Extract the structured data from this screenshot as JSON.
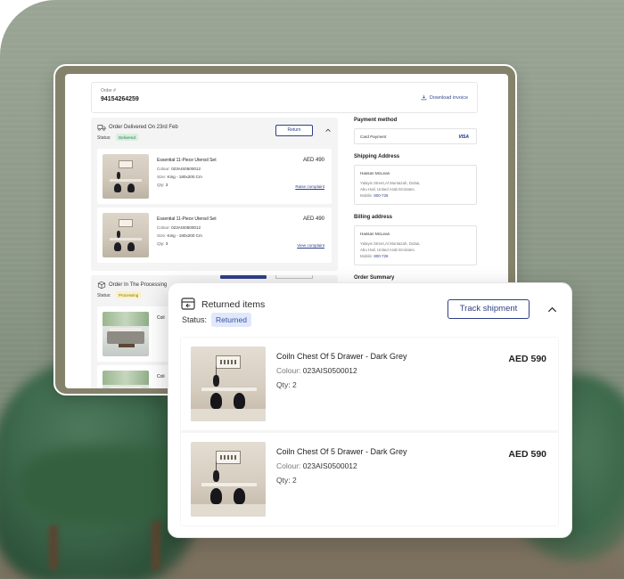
{
  "background_screen": {
    "order": {
      "label": "Order #",
      "number": "94154264259",
      "download_label": "Download invoice"
    },
    "panels": [
      {
        "title": "Order Delivered On 23rd Feb",
        "status_label": "Status:",
        "status": "Delivered",
        "action_label": "Return",
        "items": [
          {
            "name": "Essential 11-Piece Utensil Set",
            "colour_label": "Colour:",
            "colour": "023AIS0500012",
            "size_label": "Size:",
            "size": "King - 180x200 Cm",
            "qty_label": "Qty:",
            "qty": "3",
            "price": "AED 490",
            "link": "Raise complaint"
          },
          {
            "name": "Essential 11-Piece Utensil Set",
            "colour_label": "Colour:",
            "colour": "023AIS0500012",
            "size_label": "Size:",
            "size": "King - 180x200 Cm",
            "qty_label": "Qty:",
            "qty": "3",
            "price": "AED 490",
            "link": "View complaint"
          }
        ]
      },
      {
        "title": "Order In The Processing",
        "status_label": "Status:",
        "status": "Processing",
        "items": [
          {
            "name": "Coli"
          },
          {
            "name": "Coli"
          }
        ]
      }
    ],
    "sidebar": {
      "payment_title": "Payment method",
      "payment_value": "Card Payment",
      "payment_brand": "VISA",
      "shipping_title": "Shipping Address",
      "shipping": {
        "name": "Hassan McLean",
        "line1": "Yalayis Street,Al Muntazah, Dubai,",
        "line2": "Abu Hail, United Arab Emirates.",
        "mobile_label": "Mobile:",
        "mobile": "800-726"
      },
      "billing_title": "Billing address",
      "billing": {
        "name": "Hassan McLean",
        "line1": "Yalayis Street,Al Muntazah, Dubai,",
        "line2": "Abu Hail, United Arab Emirates.",
        "mobile_label": "Mobile:",
        "mobile": "800-726"
      },
      "summary_title": "Order Summary"
    }
  },
  "returned_card": {
    "title": "Returned items",
    "status_label": "Status:",
    "status": "Returned",
    "track_label": "Track shipment",
    "items": [
      {
        "name": "Coiln Chest Of 5 Drawer - Dark Grey",
        "colour_label": "Colour:",
        "colour": "023AIS0500012",
        "qty_label": "Qty:",
        "qty": "2",
        "price": "AED 590"
      },
      {
        "name": "Coiln Chest Of 5 Drawer - Dark Grey",
        "colour_label": "Colour:",
        "colour": "023AIS0500012",
        "qty_label": "Qty:",
        "qty": "2",
        "price": "AED 590"
      }
    ]
  },
  "colors": {
    "accent": "#2f3f85",
    "badge_returned_bg": "#e0e8fa",
    "badge_delivered_bg": "#d8efe0",
    "badge_processing_bg": "#fbf1c4",
    "monitor_bezel": "#85826b"
  },
  "icons": {
    "download": "download-icon",
    "delivered": "truck-icon",
    "processing": "box-icon",
    "returned": "return-box-icon",
    "collapse": "chevron-up-icon"
  }
}
